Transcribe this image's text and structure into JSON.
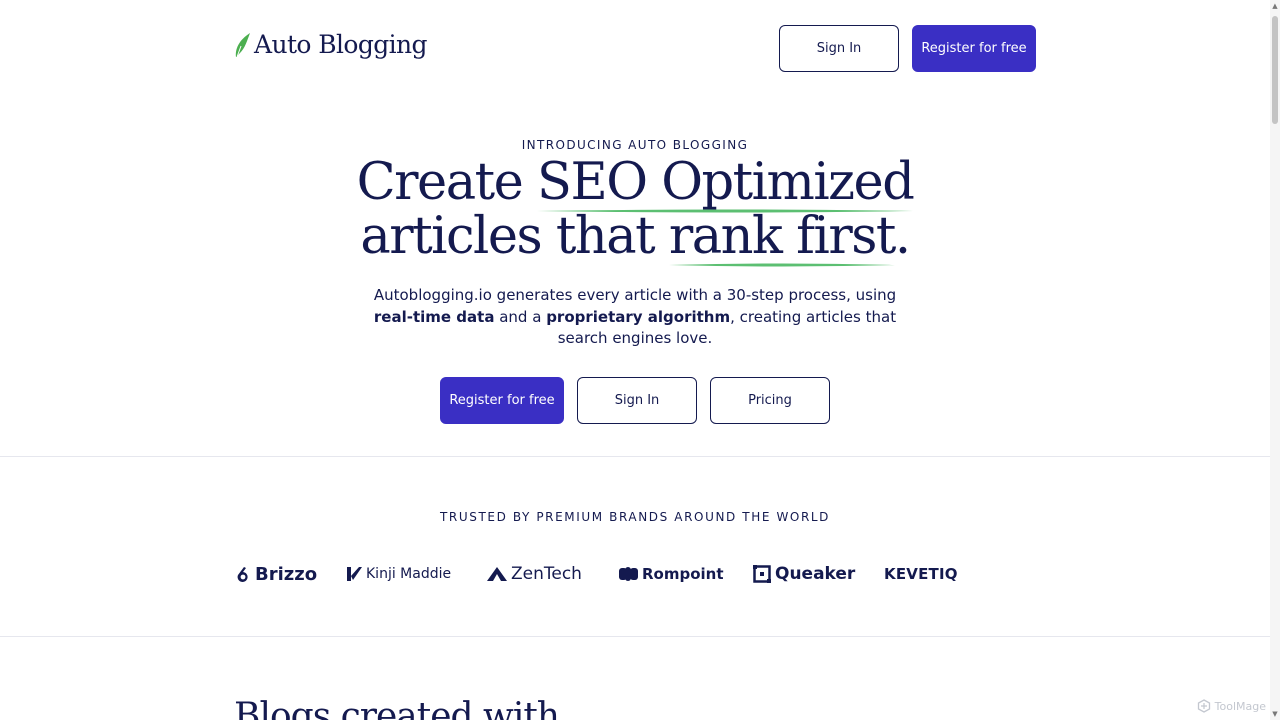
{
  "header": {
    "logo_text": "Auto Blogging",
    "signin_label": "Sign In",
    "register_label": "Register for free"
  },
  "hero": {
    "eyebrow": "INTRODUCING AUTO BLOGGING",
    "headline_line1_prefix": "Create ",
    "headline_line1_highlight": "SEO Optimized",
    "headline_line2_prefix": "articles that ",
    "headline_line2_highlight": "rank first",
    "headline_line2_suffix": ".",
    "subcopy_part1": "Autoblogging.io generates every article with a 30-step process, using ",
    "subcopy_bold1": "real-time data",
    "subcopy_part2": " and a ",
    "subcopy_bold2": "proprietary algorithm",
    "subcopy_part3": ", creating articles that search engines love.",
    "register_label": "Register for free",
    "signin_label": "Sign In",
    "pricing_label": "Pricing"
  },
  "trusted": {
    "heading": "TRUSTED BY PREMIUM BRANDS AROUND THE WORLD",
    "brands": [
      "Brizzo",
      "Kinji Maddie",
      "ZenTech",
      "Rompoint",
      "Queaker",
      "KEVETIQ"
    ]
  },
  "blogs": {
    "title": "Blogs created with"
  },
  "watermark": {
    "text": "ToolMage"
  },
  "colors": {
    "navy": "#141a4f",
    "primary": "#3a2fc4",
    "highlight_green": "#5cbf72",
    "logo_green": "#4caf50"
  }
}
